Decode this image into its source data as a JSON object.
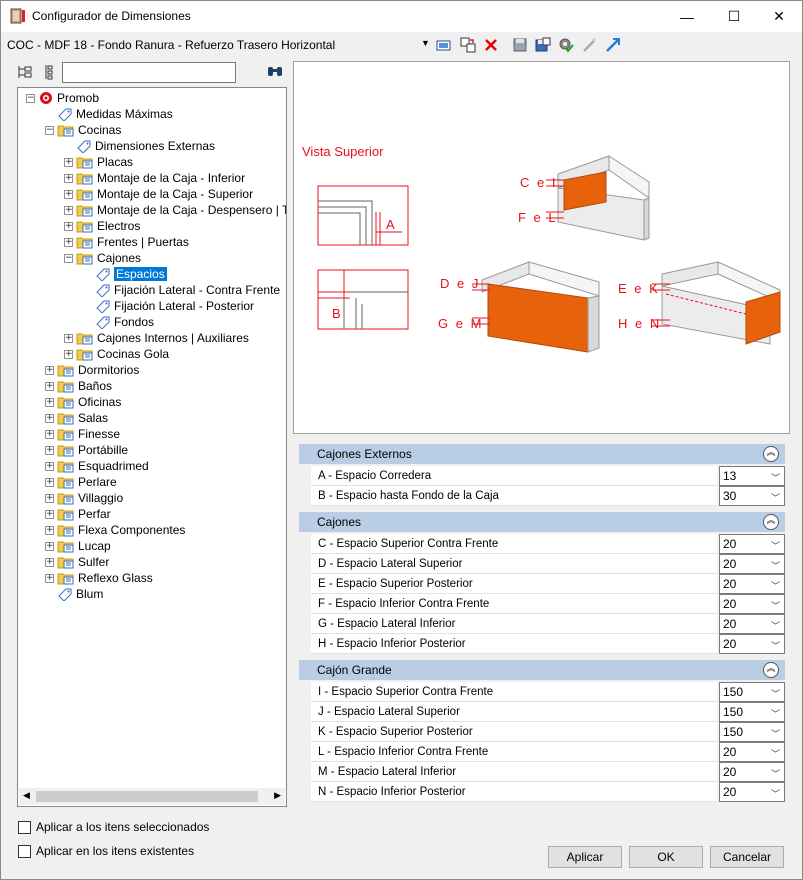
{
  "window": {
    "title": "Configurador de Dimensiones",
    "minimize": "—",
    "maximize": "☐",
    "close": "✕"
  },
  "toolbar": {
    "model_name": "COC - MDF 18 - Fondo Ranura - Refuerzo Trasero Horizontal",
    "dropdown_arrow": "▼"
  },
  "tree": {
    "items": [
      {
        "label": "Promob",
        "level": 0,
        "exp": "−",
        "icon": "promob"
      },
      {
        "label": "Medidas Máximas",
        "level": 1,
        "exp": "",
        "icon": "tag"
      },
      {
        "label": "Cocinas",
        "level": 1,
        "exp": "−",
        "icon": "folder"
      },
      {
        "label": "Dimensiones Externas",
        "level": 2,
        "exp": "",
        "icon": "tag"
      },
      {
        "label": "Placas",
        "level": 2,
        "exp": "+",
        "icon": "folder"
      },
      {
        "label": "Montaje de la Caja - Inferior",
        "level": 2,
        "exp": "+",
        "icon": "folder"
      },
      {
        "label": "Montaje de la Caja - Superior",
        "level": 2,
        "exp": "+",
        "icon": "folder"
      },
      {
        "label": "Montaje de la Caja - Despensero | Torre",
        "level": 2,
        "exp": "+",
        "icon": "folder"
      },
      {
        "label": "Electros",
        "level": 2,
        "exp": "+",
        "icon": "folder"
      },
      {
        "label": "Frentes | Puertas",
        "level": 2,
        "exp": "+",
        "icon": "folder"
      },
      {
        "label": "Cajones",
        "level": 2,
        "exp": "−",
        "icon": "folder"
      },
      {
        "label": "Espacios",
        "level": 3,
        "exp": "",
        "icon": "tag",
        "selected": true
      },
      {
        "label": "Fijación Lateral - Contra Frente",
        "level": 3,
        "exp": "",
        "icon": "tag"
      },
      {
        "label": "Fijación Lateral - Posterior",
        "level": 3,
        "exp": "",
        "icon": "tag"
      },
      {
        "label": "Fondos",
        "level": 3,
        "exp": "",
        "icon": "tag"
      },
      {
        "label": "Cajones Internos | Auxiliares",
        "level": 2,
        "exp": "+",
        "icon": "folder"
      },
      {
        "label": "Cocinas Gola",
        "level": 2,
        "exp": "+",
        "icon": "folder"
      },
      {
        "label": "Dormitorios",
        "level": 1,
        "exp": "+",
        "icon": "folder"
      },
      {
        "label": "Baños",
        "level": 1,
        "exp": "+",
        "icon": "folder"
      },
      {
        "label": "Oficinas",
        "level": 1,
        "exp": "+",
        "icon": "folder"
      },
      {
        "label": "Salas",
        "level": 1,
        "exp": "+",
        "icon": "folder"
      },
      {
        "label": "Finesse",
        "level": 1,
        "exp": "+",
        "icon": "folder"
      },
      {
        "label": "Portábille",
        "level": 1,
        "exp": "+",
        "icon": "folder"
      },
      {
        "label": "Esquadrimed",
        "level": 1,
        "exp": "+",
        "icon": "folder"
      },
      {
        "label": "Perlare",
        "level": 1,
        "exp": "+",
        "icon": "folder"
      },
      {
        "label": "Villaggio",
        "level": 1,
        "exp": "+",
        "icon": "folder"
      },
      {
        "label": "Perfar",
        "level": 1,
        "exp": "+",
        "icon": "folder"
      },
      {
        "label": "Flexa Componentes",
        "level": 1,
        "exp": "+",
        "icon": "folder"
      },
      {
        "label": "Lucap",
        "level": 1,
        "exp": "+",
        "icon": "folder"
      },
      {
        "label": "Sulfer",
        "level": 1,
        "exp": "+",
        "icon": "folder"
      },
      {
        "label": "Reflexo Glass",
        "level": 1,
        "exp": "+",
        "icon": "folder"
      },
      {
        "label": "Blum",
        "level": 1,
        "exp": "",
        "icon": "tag"
      }
    ]
  },
  "preview": {
    "title": "Vista Superior",
    "labels": {
      "a": "A",
      "b": "B",
      "cel": "C e I",
      "fel": "F e L",
      "dej": "D e J",
      "gem": "G e M",
      "eek": "E e K",
      "hen": "H e N"
    }
  },
  "sections": [
    {
      "title": "Cajones Externos",
      "props": [
        {
          "label": "A - Espacio Corredera",
          "value": "13"
        },
        {
          "label": "B - Espacio hasta Fondo de la Caja",
          "value": "30"
        }
      ]
    },
    {
      "title": "Cajones",
      "props": [
        {
          "label": "C - Espacio Superior Contra Frente",
          "value": "20"
        },
        {
          "label": "D - Espacio Lateral Superior",
          "value": "20"
        },
        {
          "label": "E - Espacio Superior Posterior",
          "value": "20"
        },
        {
          "label": "F - Espacio Inferior Contra Frente",
          "value": "20"
        },
        {
          "label": "G - Espacio Lateral Inferior",
          "value": "20"
        },
        {
          "label": "H - Espacio Inferior Posterior",
          "value": "20"
        }
      ]
    },
    {
      "title": "Cajón Grande",
      "props": [
        {
          "label": "I - Espacio Superior Contra Frente",
          "value": "150"
        },
        {
          "label": "J - Espacio Lateral Superior",
          "value": "150"
        },
        {
          "label": "K - Espacio Superior Posterior",
          "value": "150"
        },
        {
          "label": "L - Espacio Inferior Contra Frente",
          "value": "20"
        },
        {
          "label": "M - Espacio Lateral Inferior",
          "value": "20"
        },
        {
          "label": "N - Espacio Inferior Posterior",
          "value": "20"
        }
      ]
    }
  ],
  "options": {
    "apply_selected": "Aplicar a los itens seleccionados",
    "apply_existing": "Aplicar en los itens existentes"
  },
  "buttons": {
    "apply": "Aplicar",
    "ok": "OK",
    "cancel": "Cancelar"
  },
  "scroll": {
    "left": "◀",
    "right": "▶"
  },
  "colors": {
    "selection": "#0078d7",
    "section_header": "#b9cde5",
    "drawing_red": "#e8101c",
    "drawer_orange": "#e8620c"
  }
}
